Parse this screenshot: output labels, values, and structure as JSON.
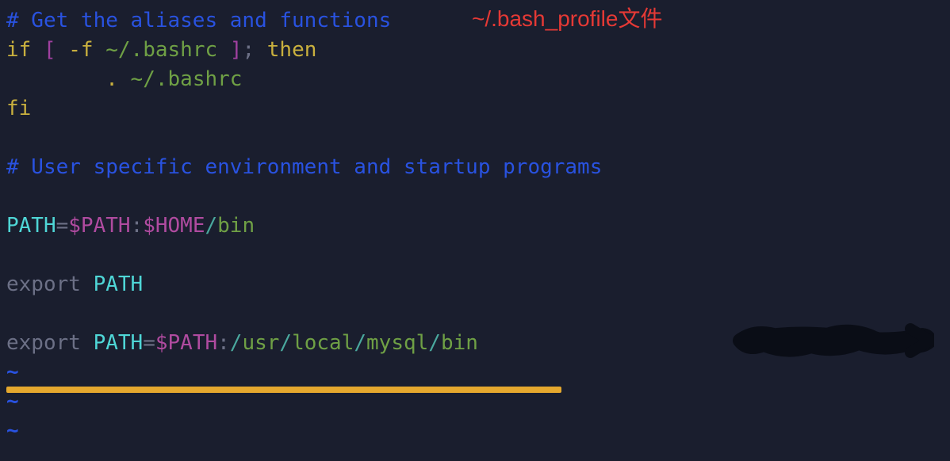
{
  "title_overlay": "~/.bash_profile文件",
  "lines": {
    "l1_comment": "# Get the aliases and functions",
    "l2": {
      "if": "if ",
      "bracket_open": "[ ",
      "flag": "-f ",
      "path": "~/.bashrc ",
      "bracket_close": "]",
      "semi_then": "; then"
    },
    "l3": {
      "indent": "        ",
      "dot": ". ",
      "path": "~/.bashrc"
    },
    "l4_fi": "fi",
    "l5_blank": "",
    "l6_comment": "# User specific environment and startup programs",
    "l7_blank": "",
    "l8": {
      "path_var": "PATH",
      "eq": "=",
      "dpath": "$PATH",
      "colon": ":",
      "dhome": "$HOME",
      "slash": "/",
      "bin": "bin"
    },
    "l9_blank": "",
    "l10": {
      "export": "export ",
      "path": "PATH"
    },
    "l11_blank": "",
    "l12": {
      "export": "export ",
      "path_var": "PATH",
      "eq": "=",
      "dpath": "$PATH",
      "colon": ":",
      "slash1": "/",
      "usr": "usr",
      "slash2": "/",
      "local": "local",
      "slash3": "/",
      "mysql": "mysql",
      "slash4": "/",
      "bin": "bin"
    },
    "tilde": "~"
  }
}
